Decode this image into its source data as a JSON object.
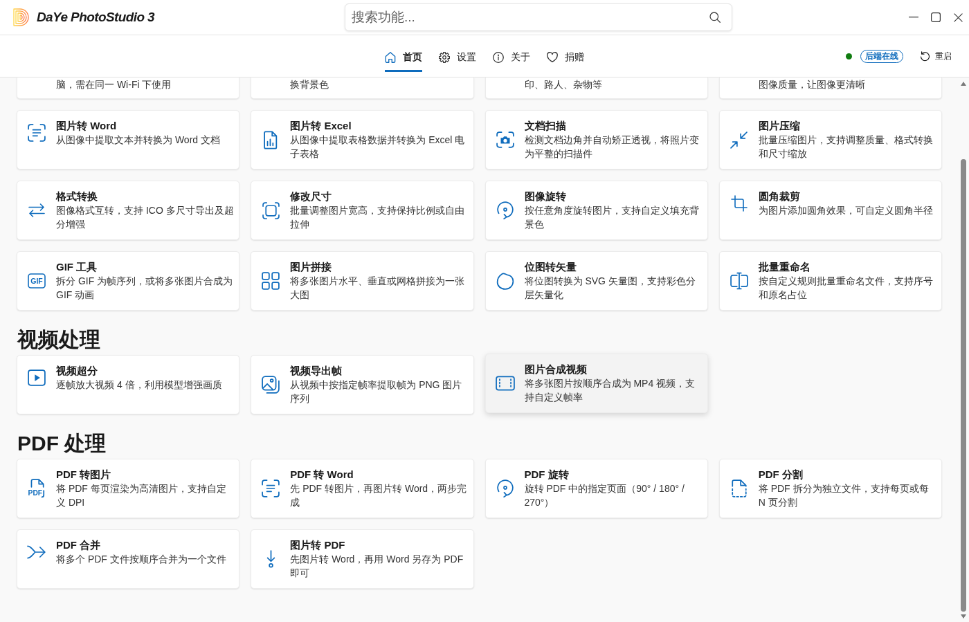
{
  "title_bar": {
    "app_title": "DaYe PhotoStudio 3",
    "search": {
      "placeholder": "搜索功能..."
    }
  },
  "nav": {
    "tabs": [
      {
        "label": "首页",
        "kind": "home",
        "selected": true
      },
      {
        "label": "设置",
        "kind": "settings",
        "selected": false
      },
      {
        "label": "关于",
        "kind": "about",
        "selected": false
      },
      {
        "label": "捐赠",
        "kind": "donate",
        "selected": false
      }
    ]
  },
  "status": {
    "online": true,
    "badge": "后端在线",
    "restart_label": "重启"
  },
  "sections": [
    {
      "cards": [
        {
          "description": "脑，需在同一 Wi-Fi 下使用",
          "hovered": false
        },
        {
          "description": "换背景色",
          "hovered": false
        },
        {
          "description": "印、路人、杂物等",
          "hovered": false
        },
        {
          "description": "图像质量，让图像更清晰",
          "hovered": false
        },
        {
          "kind": "ocr",
          "title": "图片转 Word",
          "description": "从图像中提取文本并转换为 Word 文档",
          "hovered": false
        },
        {
          "kind": "spreadsheet",
          "title": "图片转 Excel",
          "description": "从图像中提取表格数据并转换为 Excel 电子表格",
          "hovered": false
        },
        {
          "kind": "scan",
          "title": "文档扫描",
          "description": "检测文档边角并自动矫正透视，将照片变为平整的扫描件",
          "hovered": false
        },
        {
          "kind": "compress",
          "title": "图片压缩",
          "description": "批量压缩图片，支持调整质量、格式转换和尺寸缩放",
          "hovered": false
        },
        {
          "kind": "convert",
          "title": "格式转换",
          "description": "图像格式互转，支持 ICO 多尺寸导出及超分增强",
          "hovered": false
        },
        {
          "kind": "resize",
          "title": "修改尺寸",
          "description": "批量调整图片宽高，支持保持比例或自由拉伸",
          "hovered": false
        },
        {
          "kind": "rotate",
          "title": "图像旋转",
          "description": "按任意角度旋转图片，支持自定义填充背景色",
          "hovered": false
        },
        {
          "kind": "crop",
          "title": "圆角裁剪",
          "description": "为图片添加圆角效果，可自定义圆角半径",
          "hovered": false
        },
        {
          "kind": "gif",
          "icon_label": "GIF",
          "title": "GIF 工具",
          "description": "拆分 GIF 为帧序列，或将多张图片合成为 GIF 动画",
          "hovered": false
        },
        {
          "kind": "collage",
          "title": "图片拼接",
          "description": "将多张图片水平、垂直或网格拼接为一张大图",
          "hovered": false
        },
        {
          "kind": "vectorize",
          "title": "位图转矢量",
          "description": "将位图转换为 SVG 矢量图，支持彩色分层矢量化",
          "hovered": false
        },
        {
          "kind": "rename",
          "title": "批量重命名",
          "description": "按自定义规则批量重命名文件，支持序号和原名占位",
          "hovered": false
        }
      ]
    },
    {
      "heading": "视频处理",
      "cards": [
        {
          "kind": "play",
          "title": "视频超分",
          "description": "逐帧放大视频 4 倍，利用模型增强画质",
          "hovered": false
        },
        {
          "kind": "frames",
          "title": "视频导出帧",
          "description": "从视频中按指定帧率提取帧为 PNG 图片序列",
          "hovered": false
        },
        {
          "kind": "film",
          "title": "图片合成视频",
          "description": "将多张图片按顺序合成为 MP4 视频，支持自定义帧率",
          "hovered": true
        }
      ]
    },
    {
      "heading": "PDF 处理",
      "cards": [
        {
          "kind": "pdf",
          "icon_label": "PDF",
          "title": "PDF 转图片",
          "description": "将 PDF 每页渲染为高清图片，支持自定义 DPI",
          "hovered": false
        },
        {
          "kind": "ocr",
          "title": "PDF 转 Word",
          "description": "先 PDF 转图片，再图片转 Word，两步完成",
          "hovered": false
        },
        {
          "kind": "rotate",
          "title": "PDF 旋转",
          "description": "旋转 PDF 中的指定页面（90° / 180° / 270°）",
          "hovered": false
        },
        {
          "kind": "split",
          "title": "PDF 分割",
          "description": "将 PDF 拆分为独立文件，支持每页或每 N 页分割",
          "hovered": false
        },
        {
          "kind": "merge",
          "title": "PDF 合并",
          "description": "将多个 PDF 文件按顺序合并为一个文件",
          "hovered": false
        },
        {
          "kind": "download",
          "title": "图片转 PDF",
          "description": "先图片转 Word，再用 Word 另存为 PDF 即可",
          "hovered": false
        }
      ]
    }
  ]
}
